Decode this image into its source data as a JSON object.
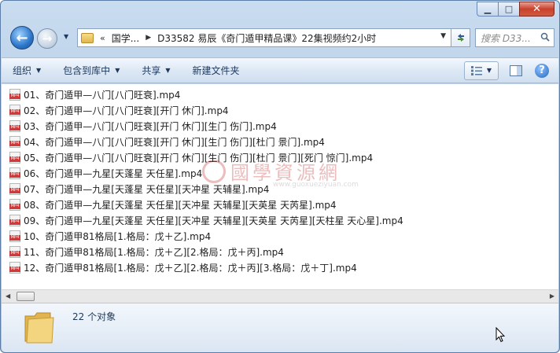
{
  "window": {
    "min_glyph": "▁",
    "max_glyph": "□",
    "close_glyph": "✕"
  },
  "nav": {
    "back_glyph": "←",
    "forward_glyph": "→",
    "address_chevron": "«",
    "address_seg1": "国学...",
    "address_seg2": "D33582 易辰《奇门遁甲精品课》22集视频约2小时",
    "search_placeholder": "搜索 D33..."
  },
  "toolbar": {
    "organize": "组织",
    "include_library": "包含到库中",
    "share": "共享",
    "new_folder": "新建文件夹"
  },
  "files": [
    "01、奇门遁甲—八门[八门旺衰].mp4",
    "02、奇门遁甲—八门[八门旺衰][开门  休门].mp4",
    "03、奇门遁甲—八门[八门旺衰][开门  休门][生门  伤门].mp4",
    "04、奇门遁甲—八门[八门旺衰][开门  休门][生门  伤门][杜门  景门].mp4",
    "05、奇门遁甲—八门[八门旺衰][开门  休门][生门  伤门][杜门  景门][死门  惊门].mp4",
    "06、奇门遁甲—九星[天蓬星  天任星].mp4",
    "07、奇门遁甲—九星[天蓬星  天任星][天冲星  天辅星].mp4",
    "08、奇门遁甲—九星[天蓬星  天任星][天冲星  天辅星][天英星  天芮星].mp4",
    "09、奇门遁甲—九星[天蓬星  天任星][天冲星  天辅星][天英星  天芮星][天柱星  天心星].mp4",
    "10、奇门遁甲81格局[1.格局：戊＋乙].mp4",
    "11、奇门遁甲81格局[1.格局：戊＋乙][2.格局：戊＋丙].mp4",
    "12、奇门遁甲81格局[1.格局：戊＋乙][2.格局：戊＋丙][3.格局：戊＋丁].mp4"
  ],
  "watermark": {
    "text": "國學資源網",
    "url": "www.guoxueziyuan.com"
  },
  "status": {
    "count": "22 个对象"
  },
  "icons": {
    "file": "mp4-file-icon",
    "folder": "folder-icon"
  },
  "colors": {
    "accent": "#2b76c9",
    "toolbar_text": "#1e395b",
    "mp4_badge": "#d23a3a"
  }
}
